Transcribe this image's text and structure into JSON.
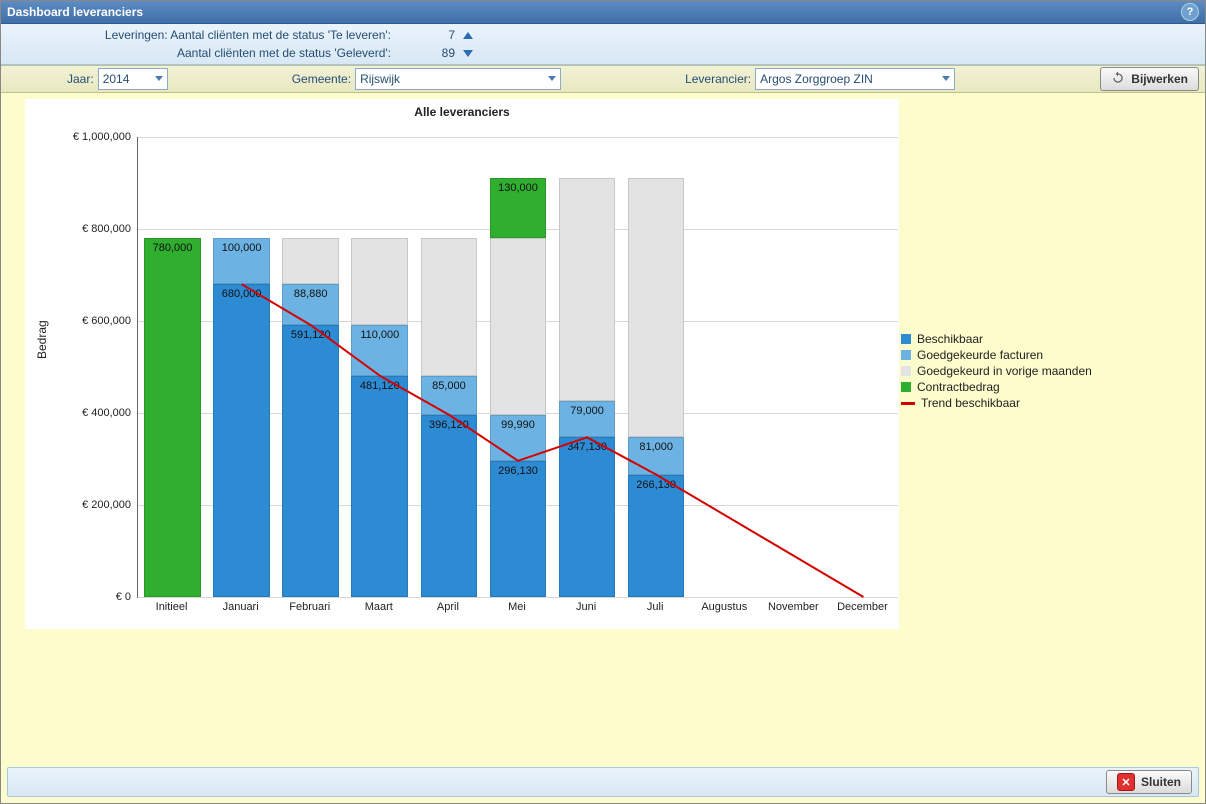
{
  "title": "Dashboard leveranciers",
  "info": {
    "leveringen_label": "Leveringen:",
    "row1_label": "Aantal cliënten met de status 'Te leveren':",
    "row1_value": "7",
    "row2_label": "Aantal cliënten met de status 'Geleverd':",
    "row2_value": "89"
  },
  "filters": {
    "jaar_label": "Jaar:",
    "jaar_value": "2014",
    "gemeente_label": "Gemeente:",
    "gemeente_value": "Rijswijk",
    "leverancier_label": "Leverancier:",
    "leverancier_value": "Argos Zorggroep ZIN",
    "bijwerken_label": "Bijwerken"
  },
  "chart_data": {
    "type": "bar",
    "title": "Alle leveranciers",
    "ylabel": "Bedrag",
    "xlabel": "",
    "ylim": [
      0,
      1000000
    ],
    "yticks": [
      0,
      200000,
      400000,
      600000,
      800000,
      1000000
    ],
    "ytick_labels": [
      "€ 0",
      "€ 200,000",
      "€ 400,000",
      "€ 600,000",
      "€ 800,000",
      "€ 1,000,000"
    ],
    "categories": [
      "Initieel",
      "Januari",
      "Februari",
      "Maart",
      "April",
      "Mei",
      "Juni",
      "Juli",
      "Augustus",
      "November",
      "December"
    ],
    "series": [
      {
        "name": "Beschikbaar",
        "color": "#2d8bd4",
        "values": [
          null,
          680000,
          591120,
          481120,
          396120,
          296130,
          347130,
          266130,
          null,
          null,
          null
        ],
        "labels": [
          null,
          "680,000",
          "591,120",
          "481,120",
          "396,120",
          "296,130",
          "347,130",
          "266,130",
          null,
          null,
          null
        ]
      },
      {
        "name": "Goedgekeurde facturen",
        "color": "#6cb3e4",
        "values": [
          null,
          100000,
          88880,
          110000,
          85000,
          99990,
          79000,
          81000,
          null,
          null,
          null
        ],
        "labels": [
          null,
          "100,000",
          "88,880",
          "110,000",
          "85,000",
          "99,990",
          "79,000",
          "81,000",
          null,
          null,
          null
        ]
      },
      {
        "name": "Goedgekeurd in vorige maanden",
        "color": "#e3e3e3",
        "values": [
          null,
          0,
          100000,
          188880,
          298880,
          383880,
          483870,
          562870,
          null,
          null,
          null
        ],
        "labels": [
          null,
          null,
          null,
          null,
          null,
          null,
          null,
          null,
          null,
          null,
          null
        ]
      },
      {
        "name": "Contractbedrag",
        "color": "#2fae2f",
        "values": [
          780000,
          0,
          0,
          0,
          0,
          130000,
          0,
          0,
          null,
          null,
          null
        ],
        "labels": [
          "780,000",
          null,
          null,
          null,
          null,
          "130,000",
          null,
          null,
          null,
          null,
          null
        ]
      }
    ],
    "trend": {
      "name": "Trend beschikbaar",
      "color": "#d40000",
      "x_index": [
        1,
        2,
        3,
        4,
        5,
        6,
        7,
        10
      ],
      "y": [
        680000,
        591120,
        481120,
        396120,
        296130,
        347130,
        266130,
        0
      ]
    }
  },
  "legend_labels": {
    "beschikbaar": "Beschikbaar",
    "goedgekeurde": "Goedgekeurde facturen",
    "vorige": "Goedgekeurd in vorige maanden",
    "contract": "Contractbedrag",
    "trend": "Trend beschikbaar"
  },
  "footer": {
    "sluiten": "Sluiten"
  },
  "colors": {
    "blue": "#2d8bd4",
    "lightblue": "#6cb3e4",
    "grey": "#e3e3e3",
    "green": "#2fae2f",
    "red": "#d40000"
  }
}
